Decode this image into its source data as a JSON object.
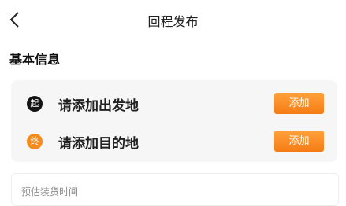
{
  "header": {
    "title": "回程发布",
    "back_icon": "chevron-left-icon"
  },
  "section": {
    "title": "基本信息"
  },
  "route": {
    "start": {
      "badge": "起",
      "label": "请添加出发地",
      "button": "添加",
      "badge_color": "#141414"
    },
    "end": {
      "badge": "终",
      "label": "请添加目的地",
      "button": "添加",
      "badge_color": "#f58b1f"
    }
  },
  "load_time": {
    "placeholder": "预估装货时间"
  },
  "colors": {
    "accent": "#f58b1f",
    "card_bg": "#f6f6f6"
  }
}
